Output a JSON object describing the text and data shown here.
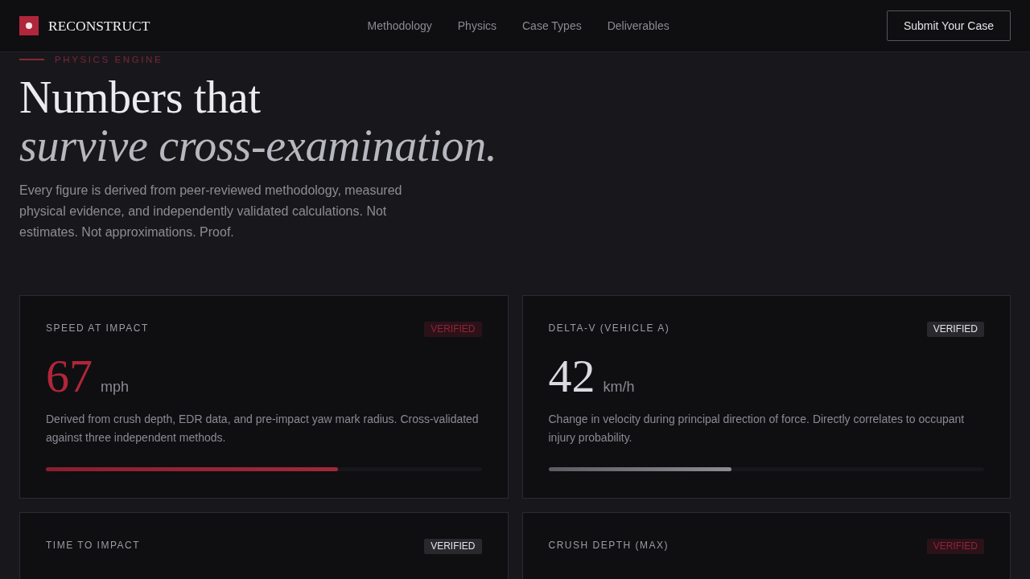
{
  "nav": {
    "brand": "RECONSTRUCT",
    "links": [
      {
        "label": "Methodology"
      },
      {
        "label": "Physics"
      },
      {
        "label": "Case Types"
      },
      {
        "label": "Deliverables"
      }
    ],
    "cta": "Submit Your Case"
  },
  "hero": {
    "eyebrow": "PHYSICS ENGINE",
    "heading": "Numbers that *survive cross-examination.*",
    "lead": "Every figure is derived from peer-reviewed methodology, measured physical evidence, and independently validated calculations. Not estimates. Not approximations. Proof."
  },
  "metrics": [
    {
      "label": "SPEED AT IMPACT",
      "badge": "VERIFIED",
      "highlighted": true,
      "value": "67",
      "unit": "mph",
      "description": "Derived from crush depth, EDR data, and pre-impact yaw mark radius. Cross-validated against three independent methods.",
      "level": 0.67
    },
    {
      "label": "DELTA-V (VEHICLE A)",
      "badge": "VERIFIED",
      "highlighted": false,
      "value": "42",
      "unit": "km/h",
      "description": "Change in velocity during principal direction of force. Directly correlates to occupant injury probability.",
      "level": 0.42
    },
    {
      "label": "TIME TO IMPACT",
      "badge": "VERIFIED",
      "highlighted": false
    },
    {
      "label": "CRUSH DEPTH (MAX)",
      "badge": "VERIFIED",
      "highlighted": true
    }
  ]
}
